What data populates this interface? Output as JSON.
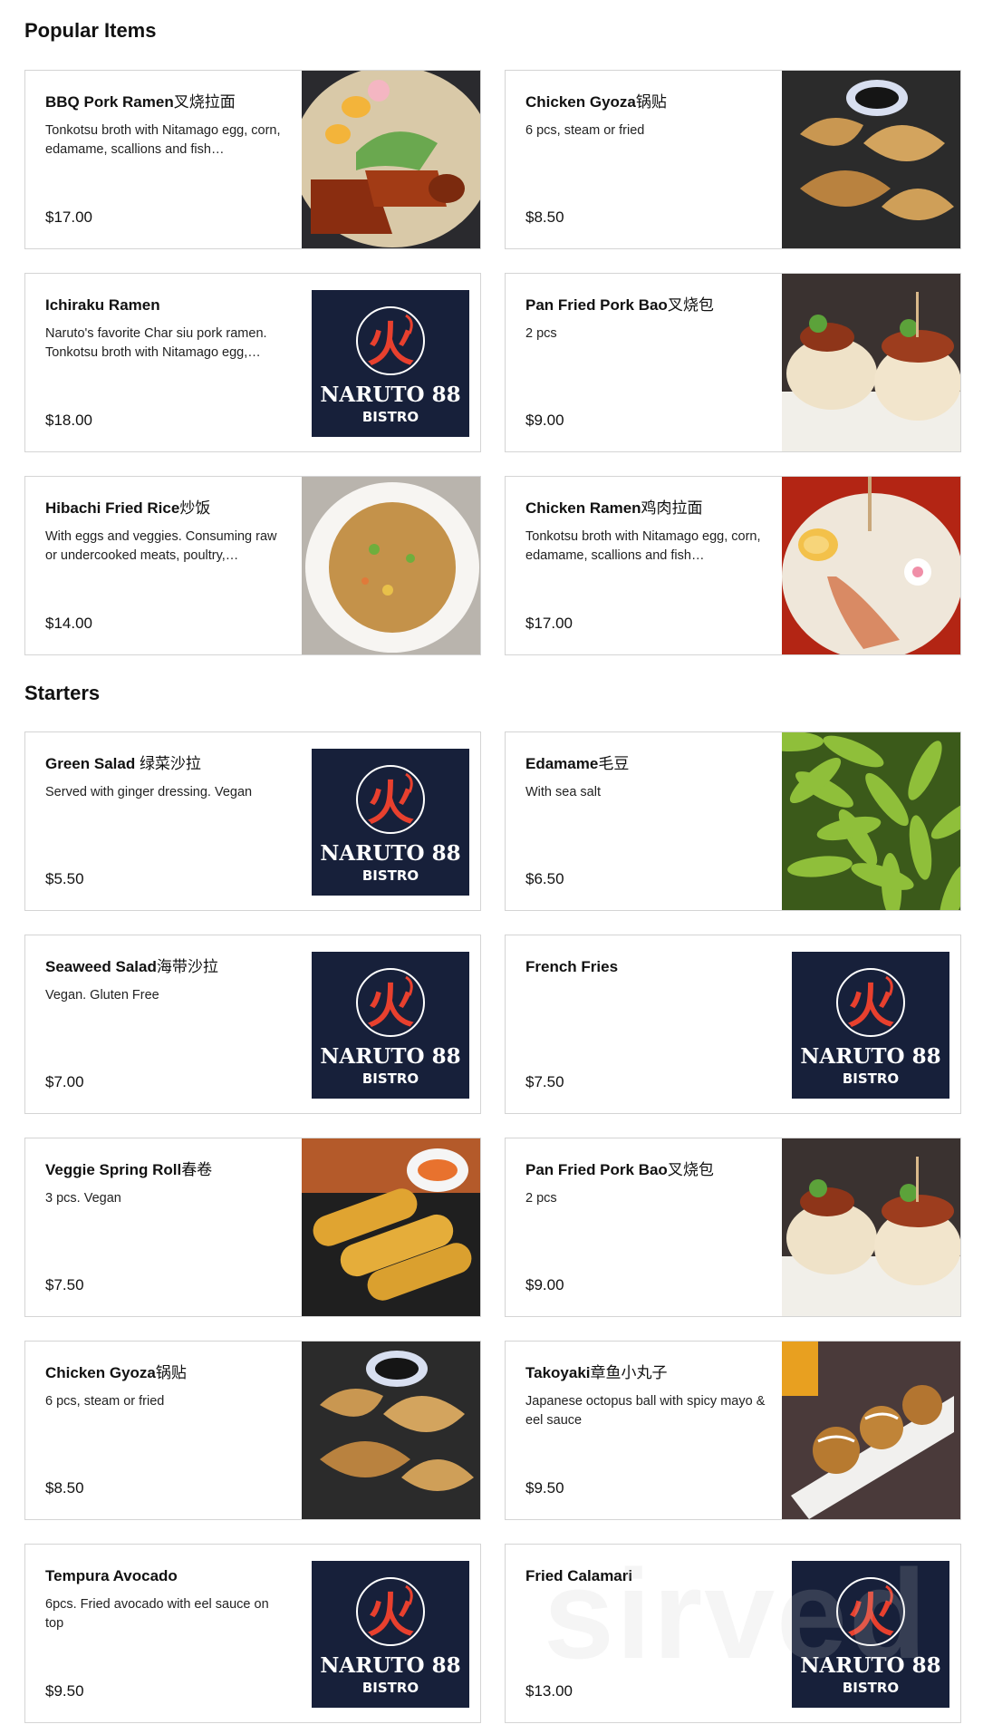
{
  "sections": [
    {
      "title": "Popular Items",
      "items": [
        {
          "name": "BBQ Pork Ramen",
          "name_zh": "叉烧拉面",
          "desc": "Tonkotsu broth with Nitamago egg, corn, edamame, scallions and fish…",
          "price": "$17.00",
          "image": "ramen-bbq-photo"
        },
        {
          "name": "Chicken Gyoza",
          "name_zh": "锅贴",
          "desc": "6 pcs, steam or fried",
          "price": "$8.50",
          "image": "gyoza-photo"
        },
        {
          "name": "Ichiraku Ramen",
          "name_zh": "",
          "desc": "Naruto's favorite Char siu pork ramen. Tonkotsu broth with Nitamago egg,…",
          "price": "$18.00",
          "image": "logo"
        },
        {
          "name": "Pan Fried Pork Bao",
          "name_zh": "叉烧包",
          "desc": "2 pcs",
          "price": "$9.00",
          "image": "bao-photo"
        },
        {
          "name": "Hibachi Fried Rice",
          "name_zh": "炒饭",
          "desc": "With eggs and veggies. Consuming raw or undercooked meats, poultry,…",
          "price": "$14.00",
          "image": "fried-rice-photo"
        },
        {
          "name": "Chicken Ramen",
          "name_zh": "鸡肉拉面",
          "desc": "Tonkotsu broth with Nitamago egg, corn, edamame, scallions and fish…",
          "price": "$17.00",
          "image": "ramen-chicken-photo"
        }
      ]
    },
    {
      "title": "Starters",
      "items": [
        {
          "name": "Green Salad ",
          "name_zh": "绿菜沙拉",
          "desc": "Served with ginger dressing. Vegan",
          "price": "$5.50",
          "image": "logo"
        },
        {
          "name": "Edamame",
          "name_zh": "毛豆",
          "desc": "With sea salt",
          "price": "$6.50",
          "image": "edamame-photo"
        },
        {
          "name": "Seaweed Salad",
          "name_zh": "海带沙拉",
          "desc": "Vegan. Gluten Free",
          "price": "$7.00",
          "image": "logo"
        },
        {
          "name": "French Fries",
          "name_zh": "",
          "desc": "",
          "price": "$7.50",
          "image": "logo"
        },
        {
          "name": "Veggie Spring Roll",
          "name_zh": "春卷",
          "desc": "3 pcs. Vegan",
          "price": "$7.50",
          "image": "spring-roll-photo"
        },
        {
          "name": "Pan Fried Pork Bao",
          "name_zh": "叉烧包",
          "desc": "2 pcs",
          "price": "$9.00",
          "image": "bao-photo"
        },
        {
          "name": "Chicken Gyoza",
          "name_zh": "锅贴",
          "desc": "6 pcs, steam or fried",
          "price": "$8.50",
          "image": "gyoza-photo"
        },
        {
          "name": "Takoyaki",
          "name_zh": "章鱼小丸子",
          "desc": "Japanese octopus ball with spicy mayo & eel sauce",
          "price": "$9.50",
          "image": "takoyaki-photo"
        },
        {
          "name": "Tempura Avocado",
          "name_zh": "",
          "desc": "6pcs. Fried avocado with eel sauce on top",
          "price": "$9.50",
          "image": "logo"
        },
        {
          "name": "Fried Calamari",
          "name_zh": "",
          "desc": "",
          "price": "$13.00",
          "image": "logo"
        }
      ]
    }
  ],
  "logo": {
    "line1": "NARUTO 88",
    "line2": "BISTRO",
    "glyph": "火"
  },
  "watermark": "sirved",
  "colors": {
    "logo_bg": "#17203a",
    "logo_red": "#e8402e",
    "border": "#d4d4d4"
  }
}
